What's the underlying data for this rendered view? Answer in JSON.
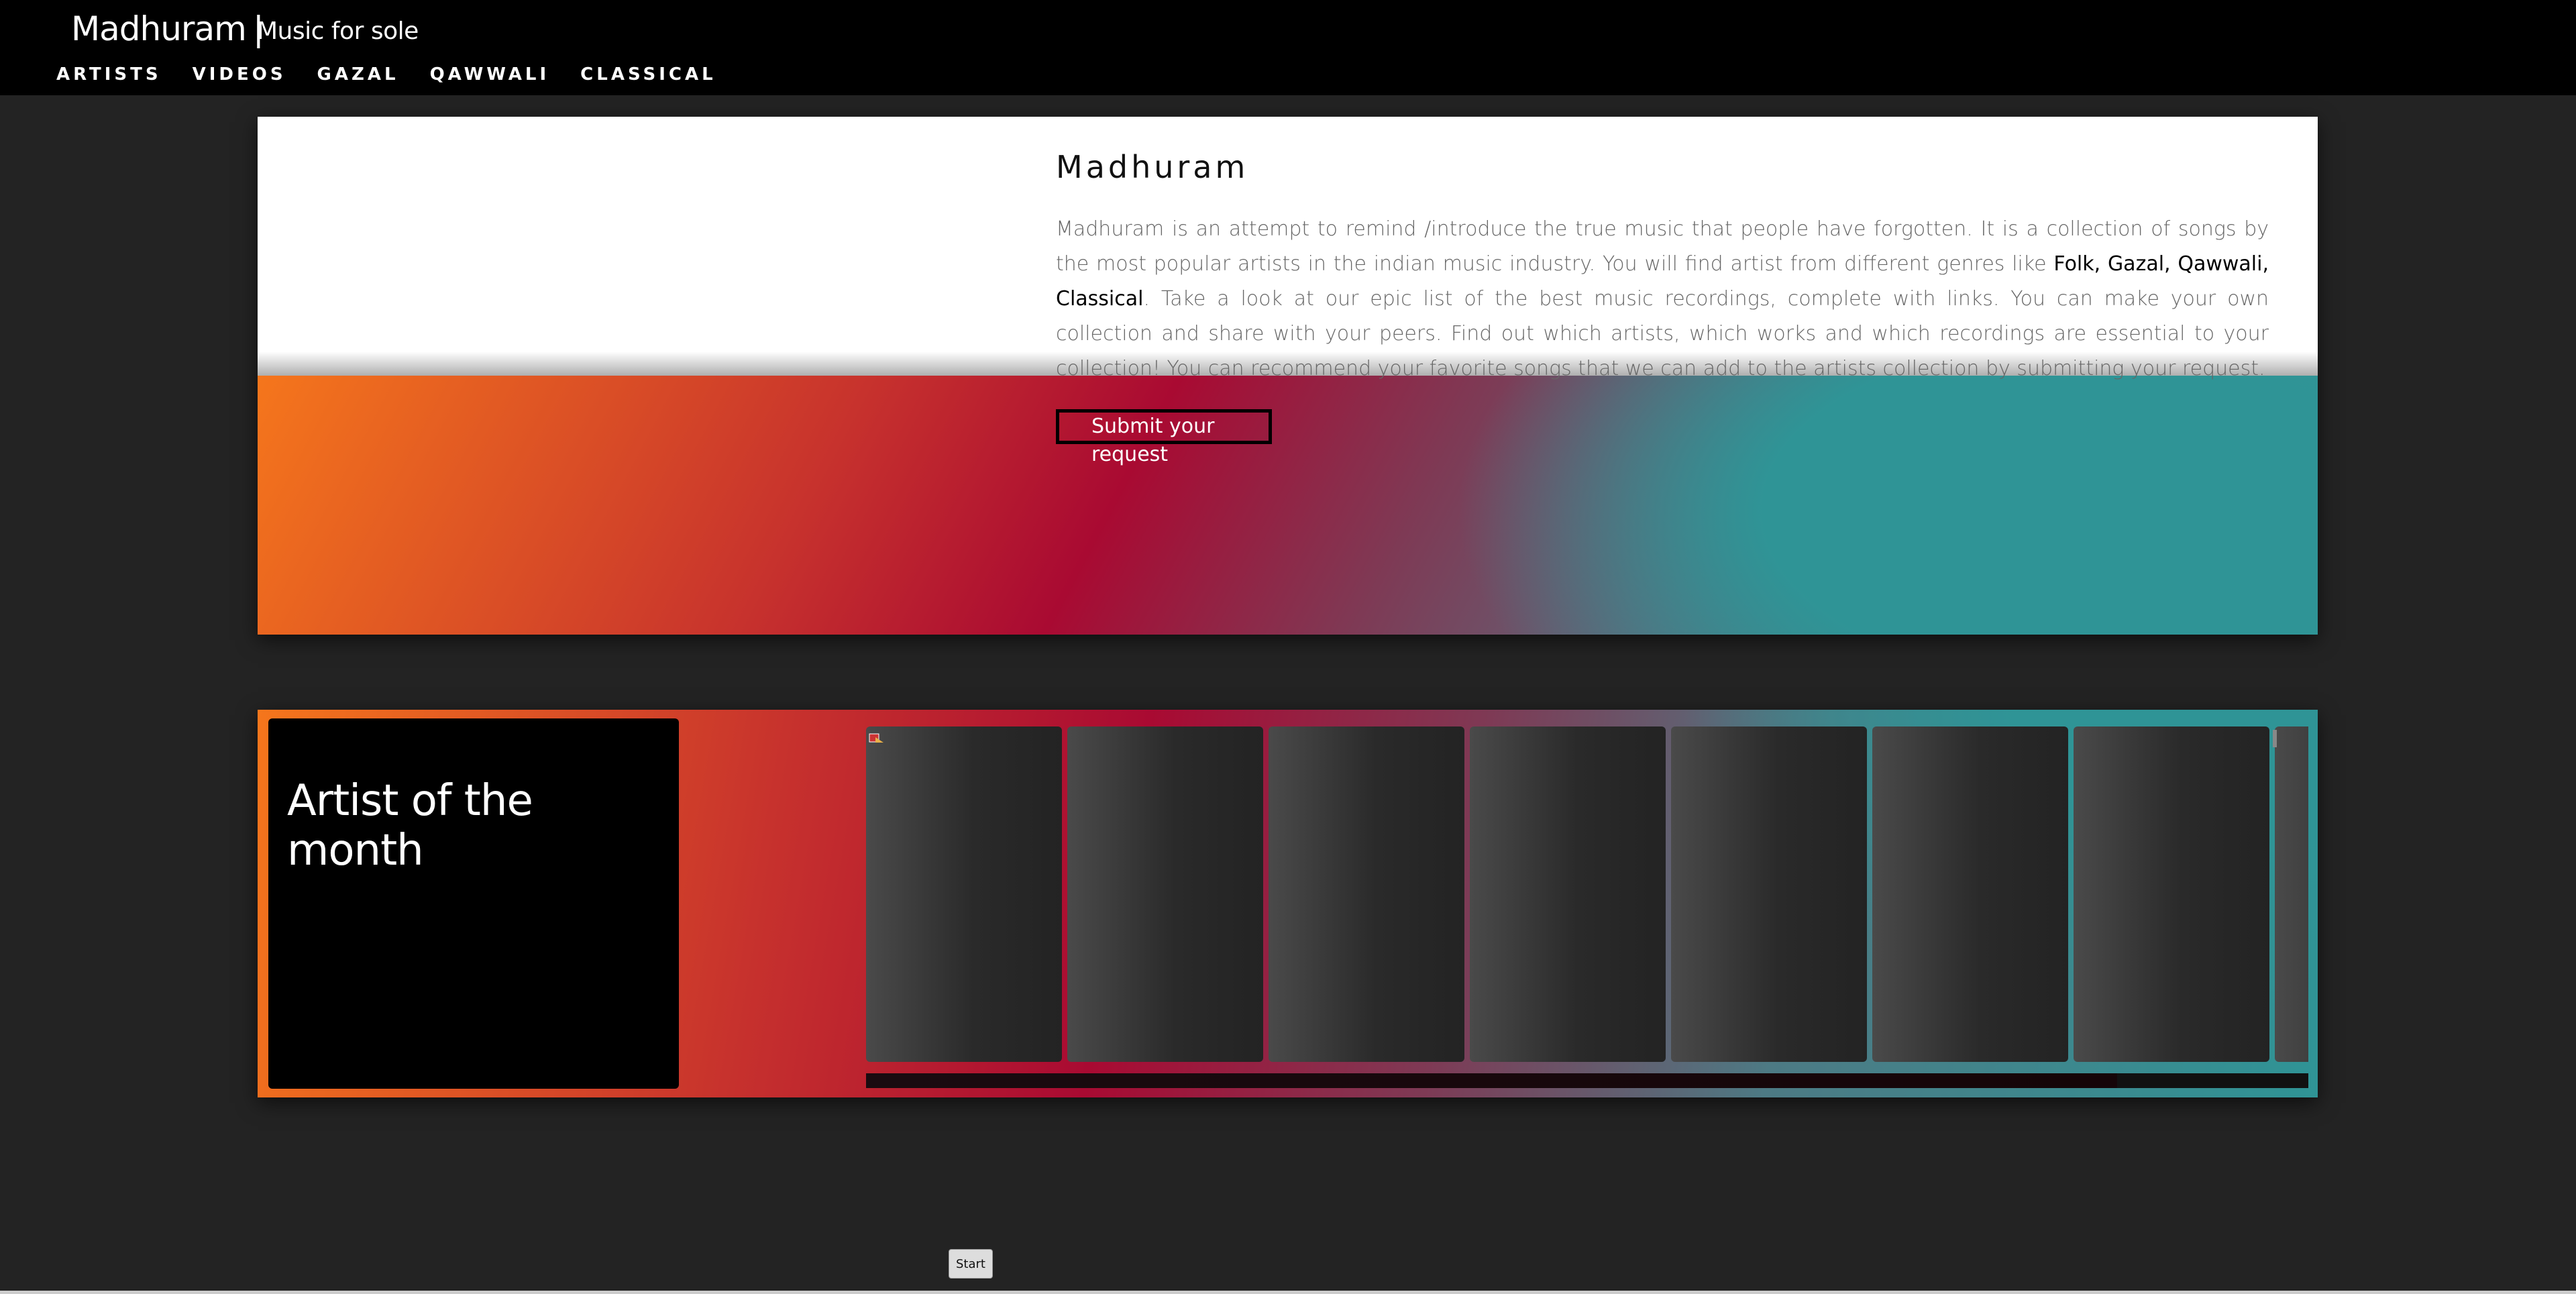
{
  "header": {
    "brand": "Madhuram",
    "separator": "|",
    "tagline": "Music for sole",
    "nav": [
      "ARTISTS",
      "VIDEOS",
      "GAZAL",
      "QAWWALI",
      "CLASSICAL"
    ]
  },
  "hero": {
    "title": "Madhuram",
    "text_part1": "Madhuram is an attempt to remind /introduce the true music that people have forgotten. It is a collection of songs by the most popular artists in the indian music industry. You will find artist from different genres like ",
    "genres": "Folk, Gazal, Qawwali, Classical",
    "text_part2": ". Take a look at our epic list of the best music recordings, complete with links. You can make your own collection and share with your peers. Find out which artists, which works and which recordings are essential to your collection! You can recommend your favorite songs that we can add to the artists collection by submitting your request.",
    "submit_label": "Submit your request"
  },
  "artist_section": {
    "title": "Artist of the month",
    "card_count": 7
  },
  "controls": {
    "start_label": "Start"
  },
  "colors": {
    "orange": "#f5761c",
    "crimson": "#a90a32",
    "teal": "#2f9496",
    "background": "#232323"
  }
}
